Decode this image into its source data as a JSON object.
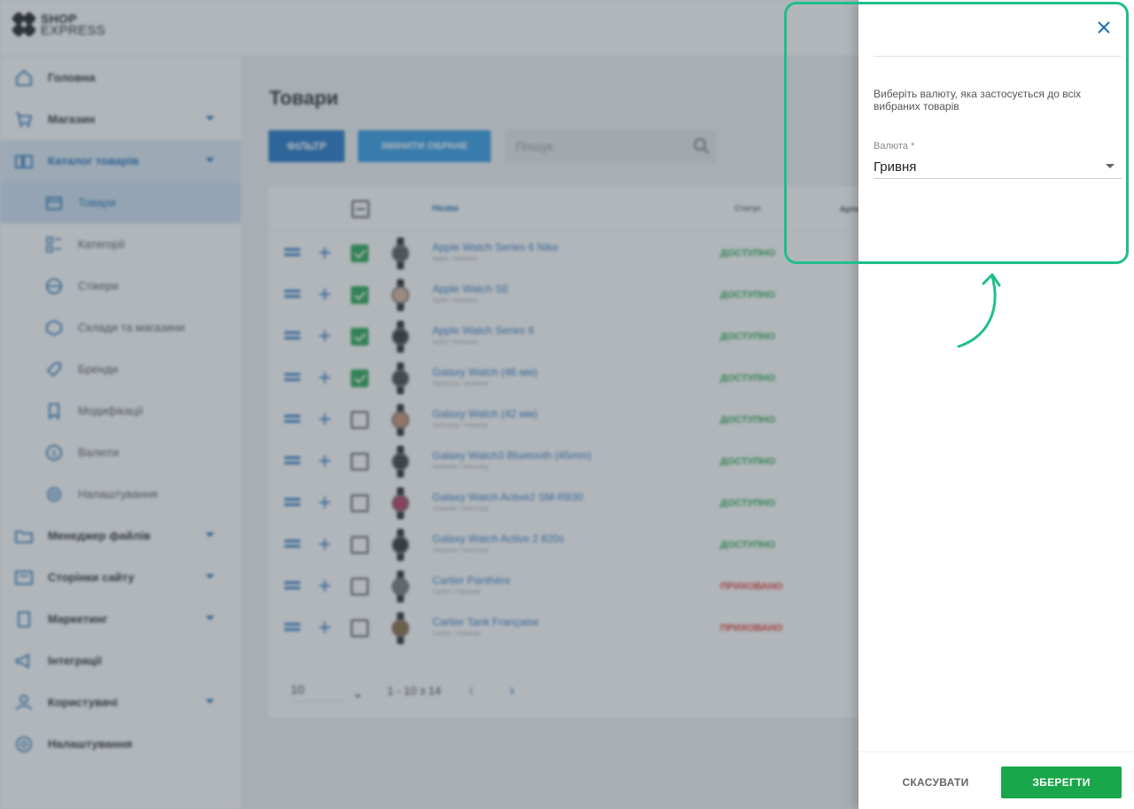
{
  "brand": {
    "line1": "SHOP",
    "line2": "EXPRESS"
  },
  "sidebar": {
    "items": [
      {
        "label": "Головна",
        "icon": "home-icon"
      },
      {
        "label": "Магазин",
        "icon": "cart-icon",
        "expandable": true
      },
      {
        "label": "Каталог товарів",
        "icon": "catalog-icon",
        "expandable": true,
        "active": true
      },
      {
        "label": "Товари",
        "icon": "box-icon",
        "sub": true,
        "current": true
      },
      {
        "label": "Категорії",
        "icon": "categories-icon",
        "sub": true
      },
      {
        "label": "Стікери",
        "icon": "sticker-icon",
        "sub": true
      },
      {
        "label": "Склади та магазини",
        "icon": "warehouse-icon",
        "sub": true
      },
      {
        "label": "Бренди",
        "icon": "tag-icon",
        "sub": true
      },
      {
        "label": "Модифікації",
        "icon": "bookmark-icon",
        "sub": true
      },
      {
        "label": "Валюти",
        "icon": "currency-icon",
        "sub": true
      },
      {
        "label": "Налаштування",
        "icon": "gear-icon",
        "sub": true
      },
      {
        "label": "Менеджер файлів",
        "icon": "folder-icon",
        "expandable": true
      },
      {
        "label": "Сторінки сайту",
        "icon": "pages-icon",
        "expandable": true
      },
      {
        "label": "Маркетинг",
        "icon": "marketing-icon",
        "expandable": true
      },
      {
        "label": "Інтеграції",
        "icon": "megaphone-icon"
      },
      {
        "label": "Користувачі",
        "icon": "users-icon",
        "expandable": true
      },
      {
        "label": "Налаштування",
        "icon": "settings-icon"
      }
    ]
  },
  "main": {
    "title": "Товари",
    "filter_label": "ФІЛЬТР",
    "change_label": "ЗМІНИТИ ОБРАНЕ",
    "search_placeholder": "Пошук",
    "columns": {
      "name": "Назва",
      "status": "Статус",
      "article": "Арти"
    },
    "rows": [
      {
        "name": "Apple Watch Series 6 Nike",
        "sub": "Apple / Новинки",
        "status": "ДОСТУПНО",
        "checked": true
      },
      {
        "name": "Apple Watch SE",
        "sub": "Apple / Новинки",
        "status": "ДОСТУПНО",
        "checked": true
      },
      {
        "name": "Apple Watch Series 6",
        "sub": "Apple / Новинки",
        "status": "ДОСТУПНО",
        "checked": true
      },
      {
        "name": "Galaxy Watch (46 мм)",
        "sub": "Samsung / Новинки",
        "status": "ДОСТУПНО",
        "checked": true
      },
      {
        "name": "Galaxy Watch (42 мм)",
        "sub": "Samsung / Новинки",
        "status": "ДОСТУПНО",
        "checked": false
      },
      {
        "name": "Galaxy Watch3 Bluetooth (45mm)",
        "sub": "Новинки / Samsung",
        "status": "ДОСТУПНО",
        "checked": false
      },
      {
        "name": "Galaxy Watch Active2 SM-R830",
        "sub": "Новинки / Samsung",
        "status": "ДОСТУПНО",
        "checked": false
      },
      {
        "name": "Galaxy Watch Active 2 820s",
        "sub": "Новинки / Samsung",
        "status": "ДОСТУПНО",
        "checked": false
      },
      {
        "name": "Cartier Panthère",
        "sub": "Cartier / Новинки",
        "status": "ПРИХОВАНО",
        "checked": false
      },
      {
        "name": "Cartier Tank Française",
        "sub": "Cartier / Новинки",
        "status": "ПРИХОВАНО",
        "checked": false
      }
    ],
    "pager": {
      "size": "10",
      "range": "1 - 10 з 14"
    }
  },
  "drawer": {
    "description": "Виберіть валюту, яка застосується до всіх вибраних товарів",
    "field_label": "Валюта *",
    "field_value": "Гривня",
    "cancel_label": "СКАСУВАТИ",
    "save_label": "ЗБЕРЕГТИ"
  },
  "colors": {
    "accent": "#1f76c6",
    "available": "#26a651",
    "hidden": "#e53935",
    "save": "#1aa64a",
    "callout": "#1ebf8a"
  }
}
